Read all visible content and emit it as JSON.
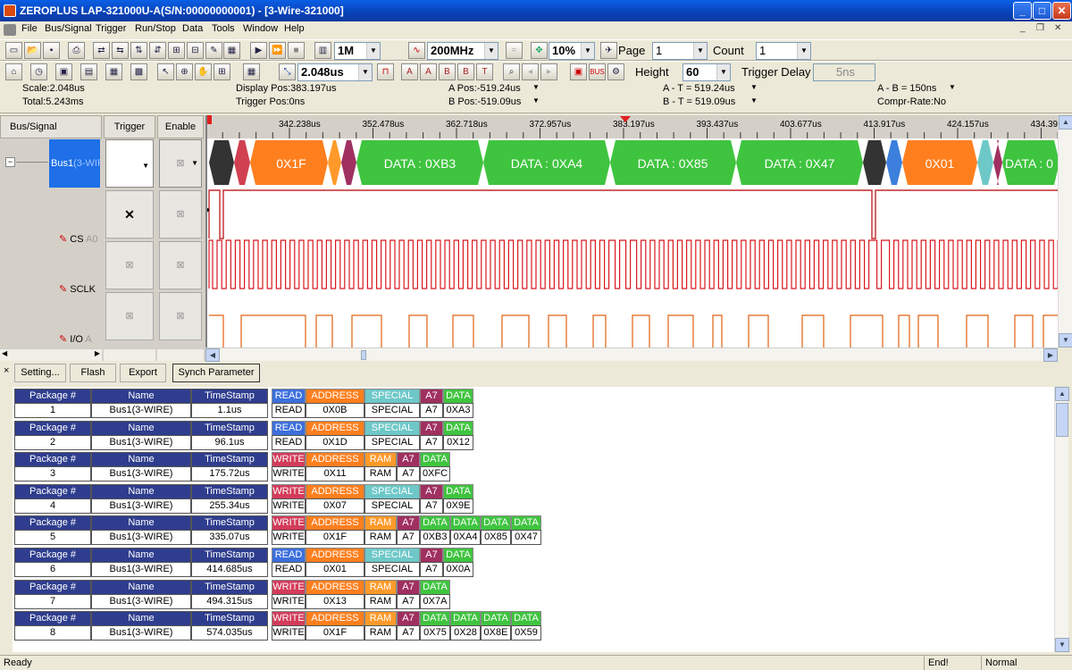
{
  "app": {
    "title": "ZEROPLUS LAP-321000U-A(S/N:00000000001) - [3-Wire-321000]"
  },
  "window_buttons": [
    "_",
    "□",
    "✕"
  ],
  "menu": [
    "File",
    "Bus/Signal",
    "Trigger",
    "Run/Stop",
    "Data",
    "Tools",
    "Window",
    "Help"
  ],
  "toolbar1": {
    "memory": "1M",
    "frequency": "200MHz",
    "zoom": "10%",
    "page_label": "Page",
    "page_value": "1",
    "count_label": "Count",
    "count_value": "1"
  },
  "toolbar2": {
    "scale": "2.048us",
    "height_label": "Height",
    "height_value": "60",
    "trigger_delay_label": "Trigger Delay",
    "trigger_delay_value": "5ns"
  },
  "info": {
    "scale": "Scale:2.048us",
    "total": "Total:5.243ms",
    "display_pos": "Display Pos:383.197us",
    "trigger_pos": "Trigger Pos:0ns",
    "a_pos": "A Pos:-519.24us",
    "b_pos": "B Pos:-519.09us",
    "a_t": "A - T = 519.24us",
    "b_t": "B - T = 519.09us",
    "a_b": "A - B = 150ns",
    "compr": "Compr-Rate:No"
  },
  "signal_panel": {
    "col_bus": "Bus/Signal",
    "col_trigger": "Trigger",
    "col_enable": "Enable",
    "bus_name": "Bus1",
    "bus_suffix": "(3-WIF",
    "signals": [
      {
        "name": "CS",
        "suffix": "A0"
      },
      {
        "name": "SCLK",
        "suffix": ""
      },
      {
        "name": "I/O",
        "suffix": "A"
      }
    ]
  },
  "ruler_ticks": [
    "342.238us",
    "352.478us",
    "362.718us",
    "372.957us",
    "383.197us",
    "393.437us",
    "403.677us",
    "413.917us",
    "424.157us",
    "434.39"
  ],
  "bus_segments": [
    "0X1F",
    "DATA : 0XB3",
    "DATA : 0XA4",
    "DATA : 0X85",
    "DATA : 0X47",
    "0X01",
    "DATA : 0"
  ],
  "colors": {
    "address": "#ff7f1e",
    "data": "#3fc43f",
    "read": "#3c6fdc",
    "write": "#d33c5a",
    "special": "#6fc8c8",
    "a7": "#a03060",
    "ram": "#ff9a2a",
    "header": "#2f3d8e",
    "cs_wave": "#c0282e",
    "sclk_wave": "#d81820",
    "io_wave": "#e06010"
  },
  "bottom_buttons": [
    "Setting...",
    "Flash",
    "Export",
    "Synch Parameter"
  ],
  "packages": [
    {
      "num": "1",
      "name": "Bus1(3-WIRE)",
      "ts": "1.1us",
      "fields": [
        {
          "h": "READ",
          "v": "READ",
          "c": "read"
        },
        {
          "h": "ADDRESS",
          "v": "0X0B",
          "c": "address"
        },
        {
          "h": "SPECIAL",
          "v": "SPECIAL",
          "c": "special"
        },
        {
          "h": "A7",
          "v": "A7",
          "c": "a7"
        },
        {
          "h": "DATA",
          "v": "0XA3",
          "c": "data"
        }
      ]
    },
    {
      "num": "2",
      "name": "Bus1(3-WIRE)",
      "ts": "96.1us",
      "fields": [
        {
          "h": "READ",
          "v": "READ",
          "c": "read"
        },
        {
          "h": "ADDRESS",
          "v": "0X1D",
          "c": "address"
        },
        {
          "h": "SPECIAL",
          "v": "SPECIAL",
          "c": "special"
        },
        {
          "h": "A7",
          "v": "A7",
          "c": "a7"
        },
        {
          "h": "DATA",
          "v": "0X12",
          "c": "data"
        }
      ]
    },
    {
      "num": "3",
      "name": "Bus1(3-WIRE)",
      "ts": "175.72us",
      "fields": [
        {
          "h": "WRITE",
          "v": "WRITE",
          "c": "write"
        },
        {
          "h": "ADDRESS",
          "v": "0X11",
          "c": "address"
        },
        {
          "h": "RAM",
          "v": "RAM",
          "c": "ram"
        },
        {
          "h": "A7",
          "v": "A7",
          "c": "a7"
        },
        {
          "h": "DATA",
          "v": "0XFC",
          "c": "data"
        }
      ]
    },
    {
      "num": "4",
      "name": "Bus1(3-WIRE)",
      "ts": "255.34us",
      "fields": [
        {
          "h": "WRITE",
          "v": "WRITE",
          "c": "write"
        },
        {
          "h": "ADDRESS",
          "v": "0X07",
          "c": "address"
        },
        {
          "h": "SPECIAL",
          "v": "SPECIAL",
          "c": "special"
        },
        {
          "h": "A7",
          "v": "A7",
          "c": "a7"
        },
        {
          "h": "DATA",
          "v": "0X9E",
          "c": "data"
        }
      ]
    },
    {
      "num": "5",
      "name": "Bus1(3-WIRE)",
      "ts": "335.07us",
      "fields": [
        {
          "h": "WRITE",
          "v": "WRITE",
          "c": "write"
        },
        {
          "h": "ADDRESS",
          "v": "0X1F",
          "c": "address"
        },
        {
          "h": "RAM",
          "v": "RAM",
          "c": "ram"
        },
        {
          "h": "A7",
          "v": "A7",
          "c": "a7"
        },
        {
          "h": "DATA",
          "v": "0XB3",
          "c": "data"
        },
        {
          "h": "DATA",
          "v": "0XA4",
          "c": "data"
        },
        {
          "h": "DATA",
          "v": "0X85",
          "c": "data"
        },
        {
          "h": "DATA",
          "v": "0X47",
          "c": "data"
        }
      ]
    },
    {
      "num": "6",
      "name": "Bus1(3-WIRE)",
      "ts": "414.685us",
      "fields": [
        {
          "h": "READ",
          "v": "READ",
          "c": "read"
        },
        {
          "h": "ADDRESS",
          "v": "0X01",
          "c": "address"
        },
        {
          "h": "SPECIAL",
          "v": "SPECIAL",
          "c": "special"
        },
        {
          "h": "A7",
          "v": "A7",
          "c": "a7"
        },
        {
          "h": "DATA",
          "v": "0X0A",
          "c": "data"
        }
      ]
    },
    {
      "num": "7",
      "name": "Bus1(3-WIRE)",
      "ts": "494.315us",
      "fields": [
        {
          "h": "WRITE",
          "v": "WRITE",
          "c": "write"
        },
        {
          "h": "ADDRESS",
          "v": "0X13",
          "c": "address"
        },
        {
          "h": "RAM",
          "v": "RAM",
          "c": "ram"
        },
        {
          "h": "A7",
          "v": "A7",
          "c": "a7"
        },
        {
          "h": "DATA",
          "v": "0X7A",
          "c": "data"
        }
      ]
    },
    {
      "num": "8",
      "name": "Bus1(3-WIRE)",
      "ts": "574.035us",
      "fields": [
        {
          "h": "WRITE",
          "v": "WRITE",
          "c": "write"
        },
        {
          "h": "ADDRESS",
          "v": "0X1F",
          "c": "address"
        },
        {
          "h": "RAM",
          "v": "RAM",
          "c": "ram"
        },
        {
          "h": "A7",
          "v": "A7",
          "c": "a7"
        },
        {
          "h": "DATA",
          "v": "0X75",
          "c": "data"
        },
        {
          "h": "DATA",
          "v": "0X28",
          "c": "data"
        },
        {
          "h": "DATA",
          "v": "0X8E",
          "c": "data"
        },
        {
          "h": "DATA",
          "v": "0X59",
          "c": "data"
        }
      ]
    }
  ],
  "pkg_headers": {
    "num": "Package #",
    "name": "Name",
    "ts": "TimeStamp"
  },
  "status": {
    "left": "Ready",
    "end": "End!",
    "mode": "Normal"
  }
}
